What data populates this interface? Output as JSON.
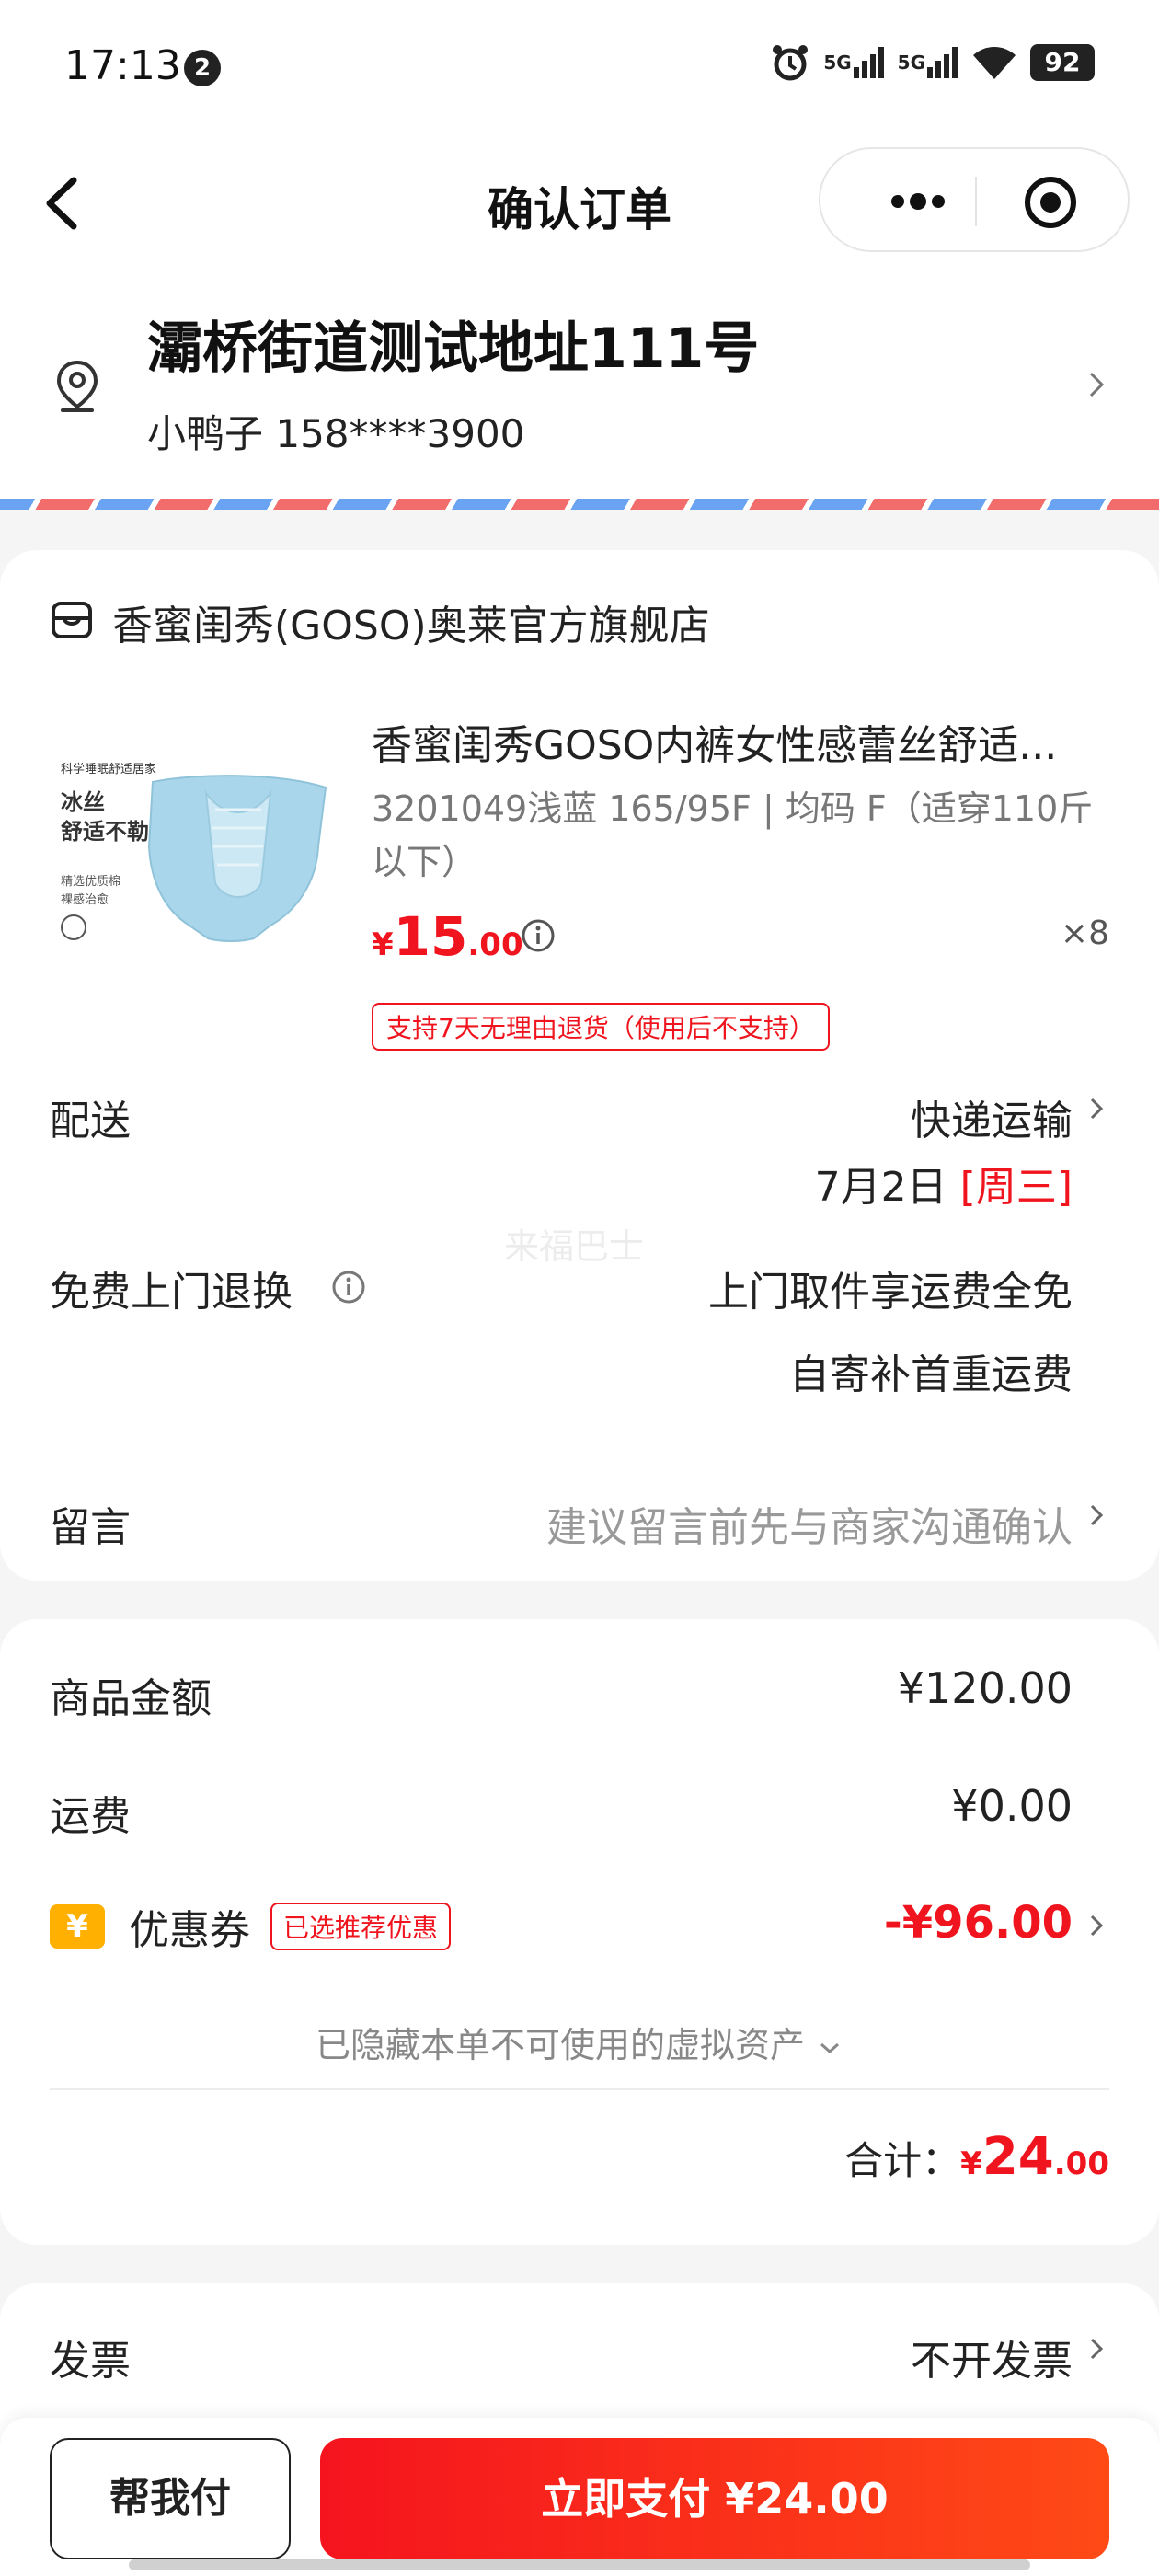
{
  "status_bar": {
    "time": "17:13",
    "notification_count": "2",
    "signal1": "5G",
    "signal2": "5G",
    "battery": "92"
  },
  "nav": {
    "title": "确认订单"
  },
  "address": {
    "line": "灞桥街道测试地址111号",
    "contact": "小鸭子 158****3900"
  },
  "shop": {
    "name": "香蜜闺秀(GOSO)奥莱官方旗舰店"
  },
  "product": {
    "title": "香蜜闺秀GOSO内裤女性感蕾丝舒适...",
    "spec": "3201049浅蓝 165/95F | 均码 F（适穿110斤以下）",
    "price_currency": "¥",
    "price_int": "15",
    "price_dec": ".00",
    "quantity": "×8",
    "return_tag": "支持7天无理由退货（使用后不支持）",
    "image_text": {
      "small": "科学睡眠舒适居家",
      "headline1": "冰丝",
      "headline2": "舒适不勒",
      "caption1": "精选优质棉",
      "caption2": "裸感治愈"
    }
  },
  "delivery": {
    "label": "配送",
    "method": "快递运输",
    "date": "7月2日",
    "weekday": "[周三]"
  },
  "watermark": "来福巴士",
  "free_return": {
    "label": "免费上门退换",
    "line1": "上门取件享运费全免",
    "line2": "自寄补首重运费"
  },
  "message": {
    "label": "留言",
    "placeholder": "建议留言前先与商家沟通确认"
  },
  "summary": {
    "goods_label": "商品金额",
    "goods_value": "¥120.00",
    "shipping_label": "运费",
    "shipping_value": "¥0.00",
    "coupon_icon": "¥",
    "coupon_label": "优惠券",
    "coupon_tag": "已选推荐优惠",
    "coupon_value": "-¥96.00",
    "hidden_assets": "已隐藏本单不可使用的虚拟资产",
    "total_label": "合计：",
    "total_currency": "¥",
    "total_int": "24",
    "total_dec": ".00"
  },
  "invoice": {
    "label": "发票",
    "value": "不开发票"
  },
  "bottom": {
    "help_pay": "帮我付",
    "pay_now": "立即支付 ¥24.00"
  },
  "colors": {
    "accent_red": "#f0141e",
    "coupon_yellow": "#ffb000"
  }
}
